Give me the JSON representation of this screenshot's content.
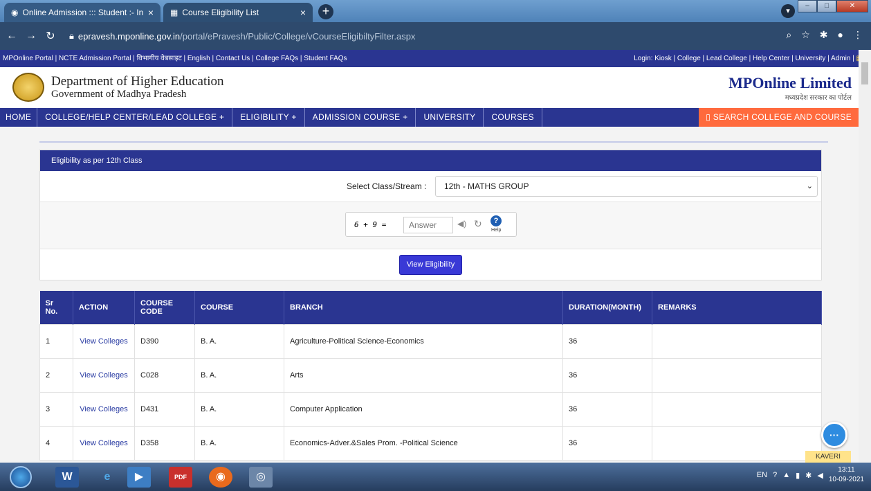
{
  "browser": {
    "tabs": [
      {
        "label": "Online Admission ::: Student :- In",
        "close": "×"
      },
      {
        "label": "Course Eligibility List",
        "close": "×"
      }
    ],
    "new_tab": "+",
    "url_host": "epravesh.mponline.gov.in",
    "url_path": "/portal/ePravesh/Public/College/vCourseEligibiltyFilter.aspx"
  },
  "links_bar": {
    "left": "MPOnline Portal | NCTE Admission Portal | विभागीय वेबसाइट | English | Contact Us | College FAQs | Student FAQs",
    "right": "Login: Kiosk | College | Lead College | Help Center | University | Admin |"
  },
  "header": {
    "department": "Department of Higher Education",
    "government": "Government of Madhya Pradesh",
    "brand": "MPOnline Limited",
    "brand_hindi": "मध्यप्रदेश सरकार का पोर्टल"
  },
  "nav": {
    "items": [
      "HOME",
      "COLLEGE/HELP CENTER/LEAD COLLEGE +",
      "ELIGIBILITY +",
      "ADMISSION COURSE +",
      "UNIVERSITY",
      "COURSES"
    ],
    "search": "SEARCH COLLEGE AND COURSE"
  },
  "panel": {
    "title": "Eligibility as per 12th Class",
    "select_label": "Select Class/Stream :",
    "select_value": "12th - MATHS GROUP",
    "captcha_question": "6 + 9 =",
    "captcha_placeholder": "Answer",
    "help_label": "Help",
    "button": "View Eligibility"
  },
  "table": {
    "headers": [
      "Sr No.",
      "ACTION",
      "COURSE CODE",
      "COURSE",
      "BRANCH",
      "DURATION(MONTH)",
      "REMARKS"
    ],
    "rows": [
      {
        "sr": "1",
        "action": "View Colleges",
        "code": "D390",
        "course": "B. A.",
        "branch": "Agriculture-Political Science-Economics",
        "duration": "36",
        "remarks": ""
      },
      {
        "sr": "2",
        "action": "View Colleges",
        "code": "C028",
        "course": "B. A.",
        "branch": "Arts",
        "duration": "36",
        "remarks": ""
      },
      {
        "sr": "3",
        "action": "View Colleges",
        "code": "D431",
        "course": "B. A.",
        "branch": "Computer Application",
        "duration": "36",
        "remarks": ""
      },
      {
        "sr": "4",
        "action": "View Colleges",
        "code": "D358",
        "course": "B. A.",
        "branch": "Economics-Adver.&Sales Prom. -Political Science",
        "duration": "36",
        "remarks": ""
      }
    ]
  },
  "chatbot": {
    "label": "KAVERI"
  },
  "taskbar": {
    "lang": "EN",
    "time": "13:11",
    "date": "10-09-2021"
  },
  "colors": {
    "nav_blue": "#2a3591",
    "search_orange": "#ff6a3d",
    "button_blue": "#3939d6"
  }
}
